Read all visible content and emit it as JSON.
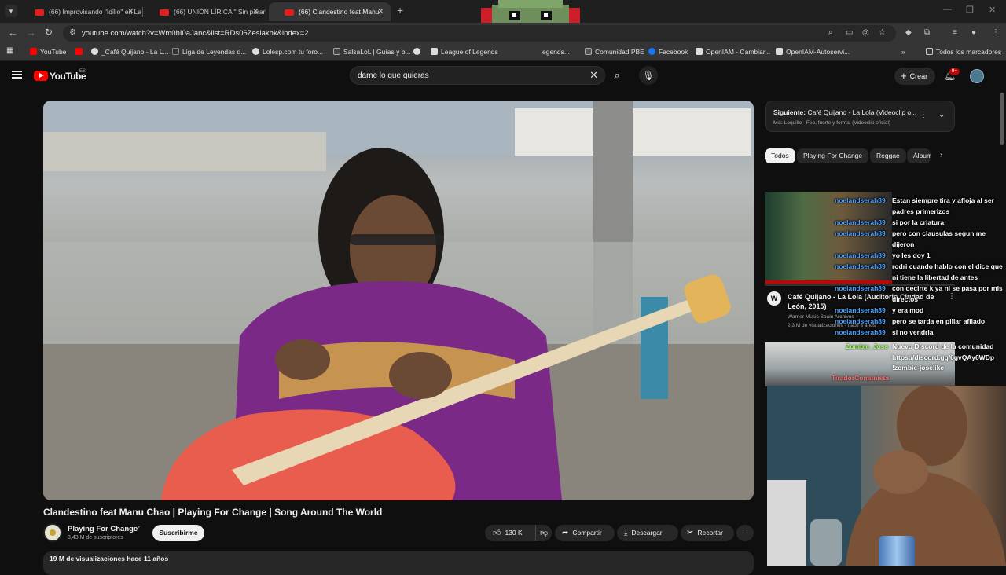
{
  "browser": {
    "tabs": [
      {
        "title": "(66) Improvisando \"Idilio\" en La",
        "active": false
      },
      {
        "title": "(66) UNIÓN LÍRICA \" Sin parar\"",
        "active": false
      },
      {
        "title": "(66) Clandestino feat Manu",
        "active": true
      }
    ],
    "url": "youtube.com/watch?v=Wm0hI0aJanc&list=RDs06Zeslakhk&index=2",
    "bookmarks": [
      {
        "label": "YouTube",
        "color": "#ff0000"
      },
      {
        "label": "",
        "color": "#ff0000"
      },
      {
        "label": "_Café Quijano - La L...",
        "color": "#dddddd"
      },
      {
        "label": "Liga de Leyendas d...",
        "color": "#333333"
      },
      {
        "label": "Lolesp.com tu foro...",
        "color": "#dddddd"
      },
      {
        "label": "SalsaLoL | Guías y b...",
        "color": "#444444"
      },
      {
        "label": "",
        "color": "#dddddd"
      },
      {
        "label": "League of Legends",
        "color": "#dddddd"
      },
      {
        "label": "egends...",
        "color": "#444444"
      },
      {
        "label": "Comunidad PBE",
        "color": "#555555"
      },
      {
        "label": "Facebook",
        "color": "#1877f2"
      },
      {
        "label": "OpenIAM - Cambiar...",
        "color": "#dddddd"
      },
      {
        "label": "OpenIAM-Autoservi...",
        "color": "#dddddd"
      }
    ],
    "all_bookmarks_label": "Todos los marcadores"
  },
  "youtube": {
    "logo_text": "YouTube",
    "region": "ES",
    "search_value": "dame lo que quieras",
    "create_label": "Crear",
    "notif_count": "9+"
  },
  "video": {
    "title": "Clandestino feat Manu Chao | Playing For Change | Song Around The World",
    "channel": "Playing For Change",
    "subscribers": "3,43 M de suscriptores",
    "subscribe_label": "Suscribirme",
    "likes": "130 K",
    "share_label": "Compartir",
    "download_label": "Descargar",
    "clip_label": "Recortar",
    "views_date": "19 M de visualizaciones  hace 11 años"
  },
  "sidebar": {
    "next_label": "Siguiente:",
    "next_title": "Café Quijano - La Lola (Videoclip o...",
    "next_mix": "Mix: Loquillo - Feo, fuerte y formal (Videoclip oficial)",
    "chips": [
      "Todos",
      "Playing For Change",
      "Reggae",
      "Álbum"
    ],
    "rec": {
      "title": "Café Quijano - La Lola (Auditorio Ciudad de León, 2015)",
      "channel": "Warner Music Spain Archivos",
      "views": "2,3 M de visualizaciones · hace 3 años",
      "avatar_letter": "W"
    }
  },
  "chat": {
    "messages": [
      {
        "user": "noelandserah89",
        "text": "Estan siempre tira y afloja al ser"
      },
      {
        "user": "",
        "text": "padres primerizos"
      },
      {
        "user": "noelandserah89",
        "text": "si por la criatura"
      },
      {
        "user": "noelandserah89",
        "text": "pero con clausulas segun me"
      },
      {
        "user": "",
        "text": "dijeron"
      },
      {
        "user": "noelandserah89",
        "text": "yo les doy 1"
      },
      {
        "user": "noelandserah89",
        "text": "rodri cuando hablo con el dice que"
      },
      {
        "user": "",
        "text": "ni tiene la libertad de antes"
      },
      {
        "user": "noelandserah89",
        "text": "con decirte k ya ni se pasa por mis"
      },
      {
        "user": "",
        "text": "directos"
      },
      {
        "user": "noelandserah89",
        "text": "y era mod"
      },
      {
        "user": "noelandserah89",
        "text": "pero se tarda en pillar afilado"
      },
      {
        "user": "noelandserah89",
        "text": "si no vendria"
      }
    ],
    "zombie_user": "Zombie_Jose",
    "zombie_text": "Nuevo Discord de la comunidad",
    "zombie_link": "https://discord.gg/6gvQAy6WDp",
    "zombie_extra": "!zombie-joselike",
    "tirador": "TiradorComunista"
  }
}
